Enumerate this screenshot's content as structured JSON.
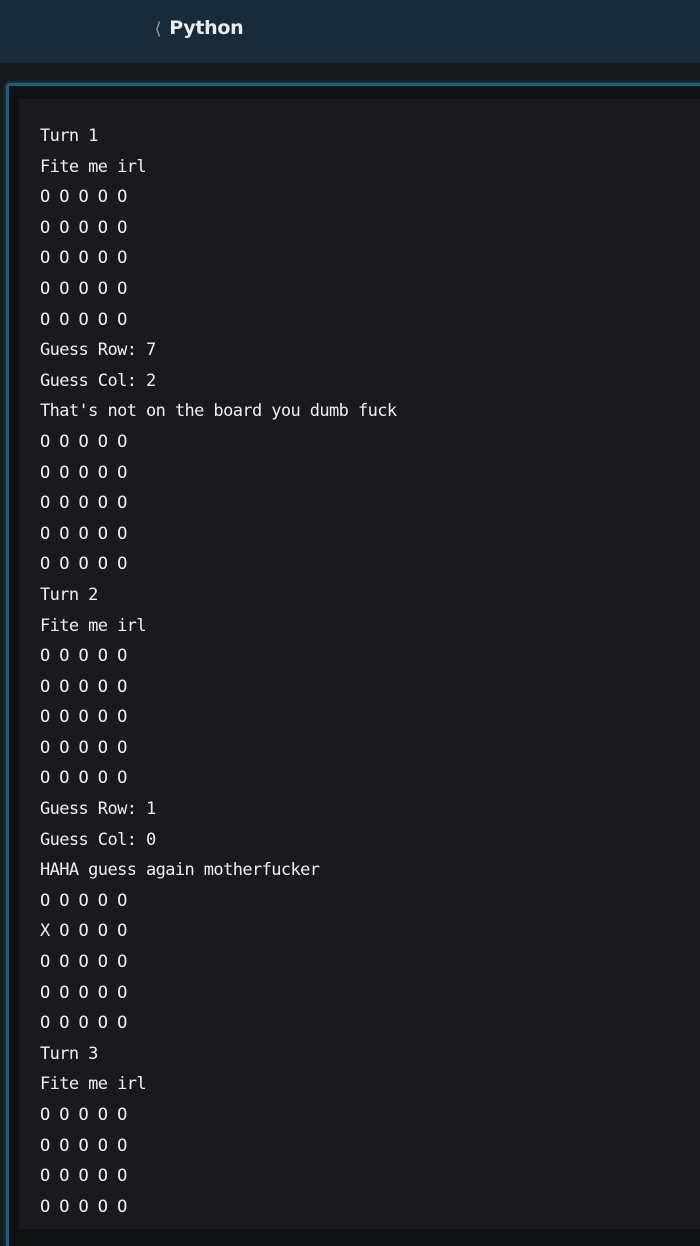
{
  "header": {
    "back_icon": "chevron-left-icon",
    "back_glyph": "❬",
    "title": "Python"
  },
  "colors": {
    "header_bg": "#182b3a",
    "console_bg": "#1a1a1c",
    "accent_border": "#1d5f85",
    "text": "#eef0f2"
  },
  "console": {
    "lines": [
      "Turn 1",
      "Fite me irl",
      "O O O O O",
      "O O O O O",
      "O O O O O",
      "O O O O O",
      "O O O O O",
      "Guess Row: 7",
      "Guess Col: 2",
      "That's not on the board you dumb fuck",
      "O O O O O",
      "O O O O O",
      "O O O O O",
      "O O O O O",
      "O O O O O",
      "Turn 2",
      "Fite me irl",
      "O O O O O",
      "O O O O O",
      "O O O O O",
      "O O O O O",
      "O O O O O",
      "Guess Row: 1",
      "Guess Col: 0",
      "HAHA guess again motherfucker",
      "O O O O O",
      "X O O O O",
      "O O O O O",
      "O O O O O",
      "O O O O O",
      "Turn 3",
      "Fite me irl",
      "O O O O O",
      "O O O O O",
      "O O O O O",
      "O O O O O"
    ]
  }
}
